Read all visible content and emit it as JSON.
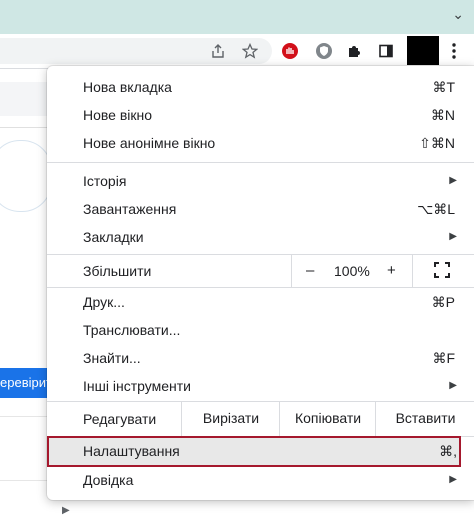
{
  "chrome": {
    "tab_chevron": "⌄",
    "icons": [
      "share-icon",
      "star-icon",
      "ublock-icon",
      "shield-extension-icon",
      "puzzle-extensions-icon",
      "sidepanel-icon",
      "profile-avatar",
      "kebab-menu-icon"
    ]
  },
  "page": {
    "blue_button_label": "еревірит"
  },
  "menu": {
    "group1": [
      {
        "label": "Нова вкладка",
        "shortcut": "⌘T"
      },
      {
        "label": "Нове вікно",
        "shortcut": "⌘N"
      },
      {
        "label": "Нове анонімне вікно",
        "shortcut": "⇧⌘N"
      }
    ],
    "group2": [
      {
        "label": "Історія",
        "submenu": true
      },
      {
        "label": "Завантаження",
        "shortcut": "⌥⌘L"
      },
      {
        "label": "Закладки",
        "submenu": true
      }
    ],
    "zoom": {
      "label": "Збільшити",
      "minus": "–",
      "value": "100%",
      "plus": "+"
    },
    "group3": [
      {
        "label": "Друк...",
        "shortcut": "⌘P"
      },
      {
        "label": "Транслювати..."
      },
      {
        "label": "Знайти...",
        "shortcut": "⌘F"
      },
      {
        "label": "Інші інструменти",
        "submenu": true
      }
    ],
    "edit": {
      "label": "Редагувати",
      "cut": "Вирізати",
      "copy": "Копіювати",
      "paste": "Вставити"
    },
    "settings": {
      "label": "Налаштування",
      "shortcut": "⌘,"
    },
    "help": {
      "label": "Довідка",
      "submenu": true
    }
  }
}
